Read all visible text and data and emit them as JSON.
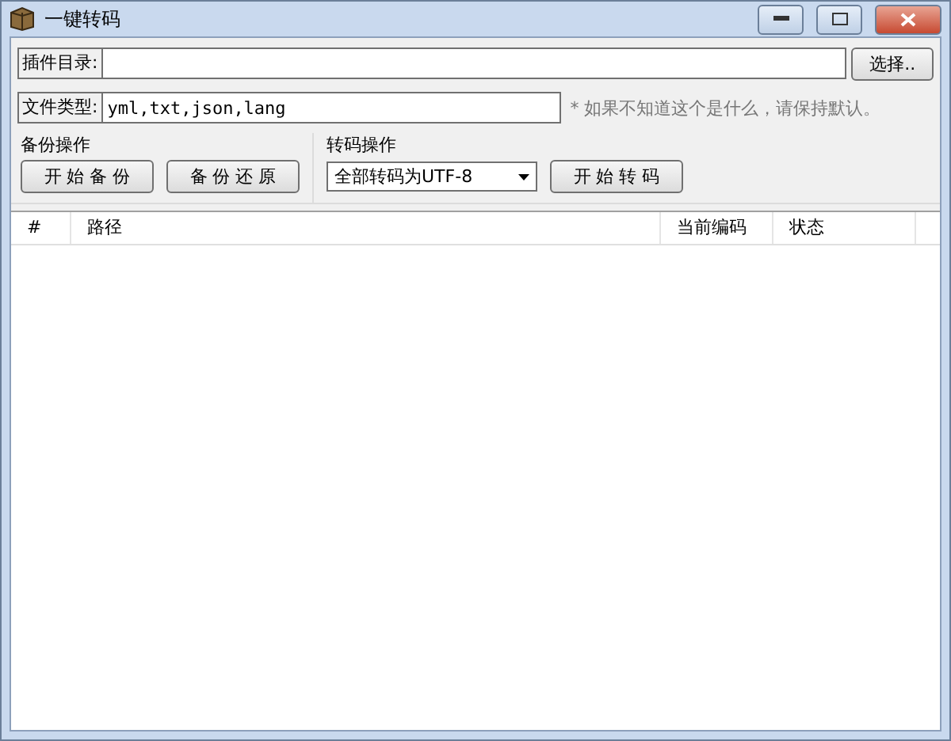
{
  "window": {
    "title": "一键转码"
  },
  "plugin_dir": {
    "label": "插件目录:",
    "button": "选择.."
  },
  "file_types": {
    "label": "文件类型:",
    "value": "yml,txt,json,lang",
    "hint": "* 如果不知道这个是什么，请保持默认。"
  },
  "backup": {
    "title": "备份操作",
    "buttons": [
      "开 始 备 份",
      "备 份 还 原"
    ]
  },
  "convert": {
    "title": "转码操作",
    "select": "全部转码为UTF-8",
    "button": "开 始 转 码"
  },
  "table": {
    "columns": [
      "#",
      "路径",
      "当前编码",
      "状态"
    ]
  }
}
